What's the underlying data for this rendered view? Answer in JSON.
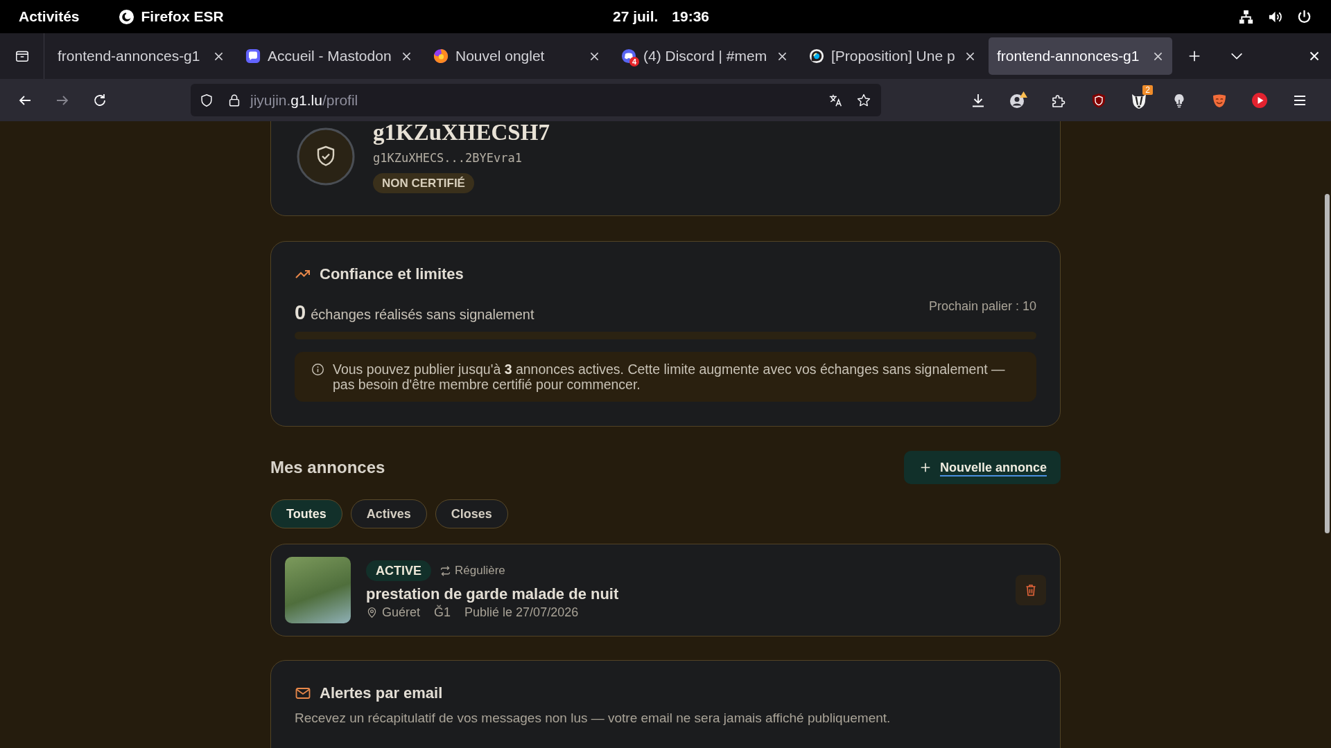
{
  "topbar": {
    "activities": "Activités",
    "app": "Firefox ESR",
    "date": "27 juil.",
    "time": "19:36"
  },
  "browser": {
    "tabs": [
      {
        "title": "frontend-annonces-g1",
        "selected": false
      },
      {
        "title": "Accueil - Mastodon",
        "selected": false
      },
      {
        "title": "Nouvel onglet",
        "selected": false
      },
      {
        "title": "(4) Discord | #mem",
        "badge": "4",
        "selected": false
      },
      {
        "title": "[Proposition] Une p",
        "selected": false
      },
      {
        "title": "frontend-annonces-g1",
        "selected": true
      }
    ],
    "back_disabled": false,
    "forward_disabled": true,
    "url": {
      "prefix": "jiyujin.",
      "host": "g1.lu",
      "path": "/profil"
    },
    "extension_badge": "2"
  },
  "profile": {
    "name": "g1KZuXHECSH7",
    "address": "g1KZuXHECS...2BYEvra1",
    "status": "NON CERTIFIÉ"
  },
  "trust": {
    "title": "Confiance et limites",
    "count": "0",
    "count_label": "échanges réalisés sans signalement",
    "next_tier": "Prochain palier : 10",
    "level": 0,
    "info": "Vous pouvez publier jusqu'à **3** annonces actives. Cette limite augmente avec vos échanges sans signalement — pas besoin d'être membre certifié pour commencer."
  },
  "listings": {
    "title": "Mes annonces",
    "new_button": "Nouvelle annonce",
    "filters": [
      {
        "label": "Toutes",
        "selected": true
      },
      {
        "label": "Actives",
        "selected": false
      },
      {
        "label": "Closes",
        "selected": false
      }
    ],
    "items": [
      {
        "status": "ACTIVE",
        "frequency": "Régulière",
        "title": "prestation de garde malade de nuit",
        "location": "Guéret",
        "currency": "Ğ1",
        "published": "Publié le 27/07/2026"
      }
    ]
  },
  "alerts": {
    "title": "Alertes par email",
    "description": "Recevez un récapitulatif de vos messages non lus — votre email ne sera jamais affiché publiquement."
  }
}
